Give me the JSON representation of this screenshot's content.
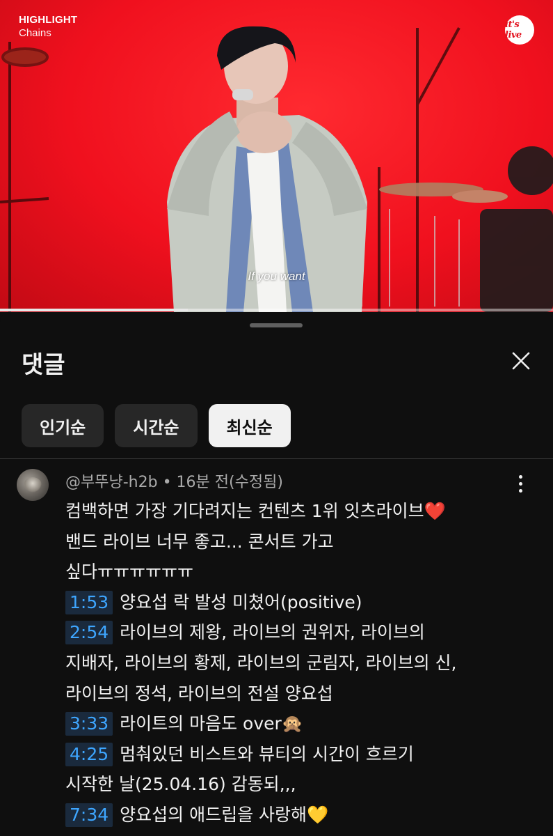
{
  "video": {
    "overlay_title": "HIGHLIGHT",
    "overlay_subtitle": "Chains",
    "logo_text": "it's live",
    "caption": "If you want",
    "progress": 0.34
  },
  "panel": {
    "title": "댓글",
    "close_icon": "close-icon",
    "sort_chips": [
      {
        "label": "인기순",
        "active": false
      },
      {
        "label": "시간순",
        "active": false
      },
      {
        "label": "최신순",
        "active": true
      }
    ]
  },
  "comment": {
    "author": "@부뚜냥-h2b",
    "meta_separator": " • ",
    "time": "16분 전(수정됨)",
    "body_lines": [
      {
        "text": "컴백하면 가장 기다려지는 컨텐츠 1위 잇츠라이브",
        "emoji": "❤️"
      },
      {
        "text": "밴드 라이브 너무 좋고... 콘서트 가고"
      },
      {
        "text": "싶다ㅠㅠㅠㅠㅠㅠ"
      },
      {
        "timestamp": "1:53",
        "text": "양요섭 락 발성 미쳤어(positive)"
      },
      {
        "timestamp": "2:54",
        "text": "라이브의 제왕, 라이브의 권위자, 라이브의"
      },
      {
        "text": "지배자, 라이브의 황제, 라이브의 군림자, 라이브의 신,"
      },
      {
        "text": "라이브의 정석, 라이브의 전설 양요섭"
      },
      {
        "timestamp": "3:33",
        "text": "라이트의 마음도 over",
        "emoji": "🙊"
      },
      {
        "timestamp": "4:25",
        "text": "멈춰있던 비스트와 뷰티의 시간이 흐르기"
      },
      {
        "text": "시작한 날(25.04.16) 감동되,,,"
      },
      {
        "timestamp": "7:34",
        "text": "양요섭의 애드립을 사랑해",
        "emoji": "💛"
      }
    ]
  }
}
